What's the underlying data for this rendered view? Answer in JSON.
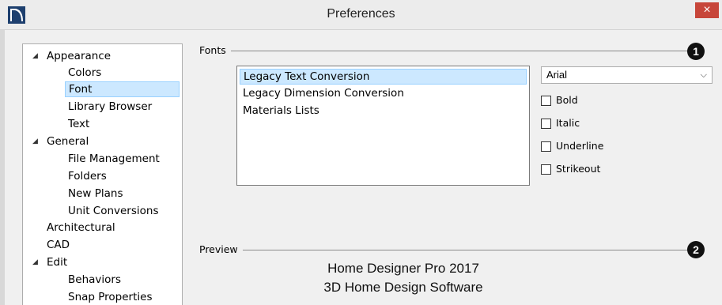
{
  "window": {
    "title": "Preferences",
    "close_glyph": "×",
    "icon": "app-logo-icon"
  },
  "tree": {
    "items": [
      {
        "label": "Appearance",
        "level": 0,
        "expanded": true
      },
      {
        "label": "Colors",
        "level": 1
      },
      {
        "label": "Font",
        "level": 1,
        "selected": true
      },
      {
        "label": "Library Browser",
        "level": 1
      },
      {
        "label": "Text",
        "level": 1
      },
      {
        "label": "General",
        "level": 0,
        "expanded": true
      },
      {
        "label": "File Management",
        "level": 1
      },
      {
        "label": "Folders",
        "level": 1
      },
      {
        "label": "New Plans",
        "level": 1
      },
      {
        "label": "Unit Conversions",
        "level": 1
      },
      {
        "label": "Architectural",
        "level": 0
      },
      {
        "label": "CAD",
        "level": 0
      },
      {
        "label": "Edit",
        "level": 0,
        "expanded": true
      },
      {
        "label": "Behaviors",
        "level": 1
      },
      {
        "label": "Snap Properties",
        "level": 1
      }
    ],
    "caret_glyph": "◢"
  },
  "fonts": {
    "group_label": "Fonts",
    "marker": "1",
    "list": [
      "Legacy Text Conversion",
      "Legacy Dimension Conversion",
      "Materials Lists"
    ],
    "selected_index": 0,
    "font_name": "Arial",
    "options": {
      "bold": "Bold",
      "italic": "Italic",
      "underline": "Underline",
      "strikeout": "Strikeout"
    }
  },
  "preview": {
    "group_label": "Preview",
    "marker": "2",
    "line1": "Home Designer Pro 2017",
    "line2": "3D Home Design Software"
  }
}
